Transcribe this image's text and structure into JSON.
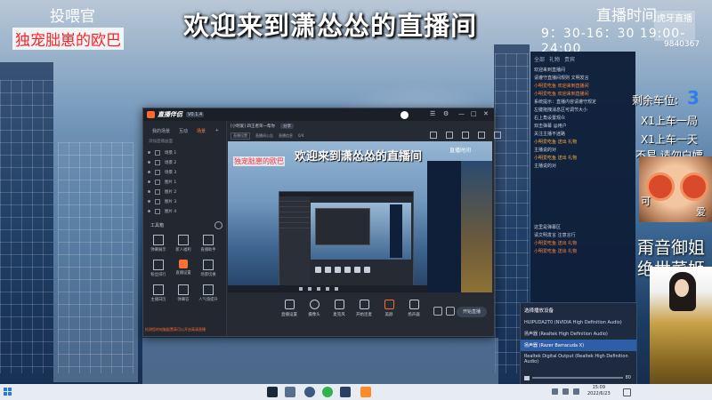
{
  "overlay": {
    "top_left_text": "投喂官",
    "red_text": "独宠朏崽的欧巴",
    "title": "欢迎来到潇怂怂的直播间",
    "time_label": "直播时间",
    "time_value": "9：30-16：30 19:00-24:00",
    "logo_text": "虎牙直播",
    "room_id": "9840367"
  },
  "right_overlay": {
    "seat_label": "剩余车位:",
    "seat_count": "3",
    "line1": "X1上车一局",
    "line2": "X1上车一天",
    "line3": "不易 请勿白嫖",
    "baby_text_left": "可",
    "baby_text_right": "爱",
    "deco1": "甭音御姐",
    "deco2": "绝世菜姬"
  },
  "chat": {
    "tabs": [
      "全部",
      "礼物",
      "贵宾"
    ],
    "lines": [
      "欢迎来到直播间",
      "请遵守直播间规则 文明发言",
      "小明爱吃鱼 欢迎来到直播间",
      "小明爱吃鱼 欢迎来到直播间",
      "系统提示：直播内容请遵守规定",
      "左键拖拽消息区可调节大小",
      "右上角设置观众",
      "双击弹幕 @用户",
      "关注主播不迷路",
      "小明爱吃鱼 送出 礼物",
      "主播说的对",
      "小明爱吃鱼 送出 礼物",
      "主播说的对",
      "",
      "",
      "",
      "",
      "",
      "",
      "",
      "",
      "",
      "这里是弹幕区",
      "请文明发言 注意言行",
      "小明爱吃鱼 送出 礼物",
      "小明爱吃鱼 送出 礼物"
    ]
  },
  "audio_popup": {
    "title": "选择播放设备",
    "items": [
      "HUIPUDA2T0 (NVIDIA High Definition Audio)",
      "扬声器 (Realtek High Definition Audio)",
      "扬声器 (Razer Barracuda X)",
      "Realtek Digital Output (Realtek High Definition Audio)"
    ],
    "selected_index": 2,
    "volume": "80"
  },
  "app": {
    "name": "直播伴侣",
    "version": "V0.1.4",
    "sidebar_tabs": [
      "我的场景",
      "互动",
      "场景"
    ],
    "sidebar_active_tab": 2,
    "hint": "添加直播画面",
    "scenes": [
      "场景 1",
      "场景 2",
      "场景 3",
      "图片 1",
      "图片 2",
      "图片 3",
      "图片 4"
    ],
    "tools_title": "工具箱",
    "tools": [
      {
        "label": "弹幕展示",
        "hot": false
      },
      {
        "label": "新人福利",
        "hot": false
      },
      {
        "label": "直播助手",
        "hot": false
      },
      {
        "label": "粉丝排行",
        "hot": false
      },
      {
        "label": "直播设置",
        "hot": true
      },
      {
        "label": "场景切换",
        "hot": false
      },
      {
        "label": "主播日历",
        "hot": false
      },
      {
        "label": "弹幕答",
        "hot": false
      },
      {
        "label": "人气值提升",
        "hot": false
      }
    ],
    "footer": "检测您的电脑配置高可以开启高清直播",
    "preview_title": "[小明爱] 四王者荣一帮你",
    "preview_tag": "分享",
    "preview_sub": [
      "直播设置",
      "直播间公告",
      "直播信息",
      "0/4"
    ],
    "stage_red": "独宠朏崽的欧巴",
    "stage_title": "欢迎来到潇怂怂的直播间",
    "stage_time": "直播时间",
    "bottom_buttons": [
      "直播设置",
      "摄像头",
      "麦克风",
      "开始连麦",
      "美颜",
      "扬声器"
    ],
    "start_label": "开始直播"
  },
  "taskbar": {
    "clock_time": "15:09",
    "clock_date": "2022/6/23"
  },
  "colors": {
    "accent_orange": "#ff6a2a",
    "overlay_red": "#ff2020",
    "seat_blue": "#2d7ee8",
    "chat_bg": "#0f1f3a"
  }
}
